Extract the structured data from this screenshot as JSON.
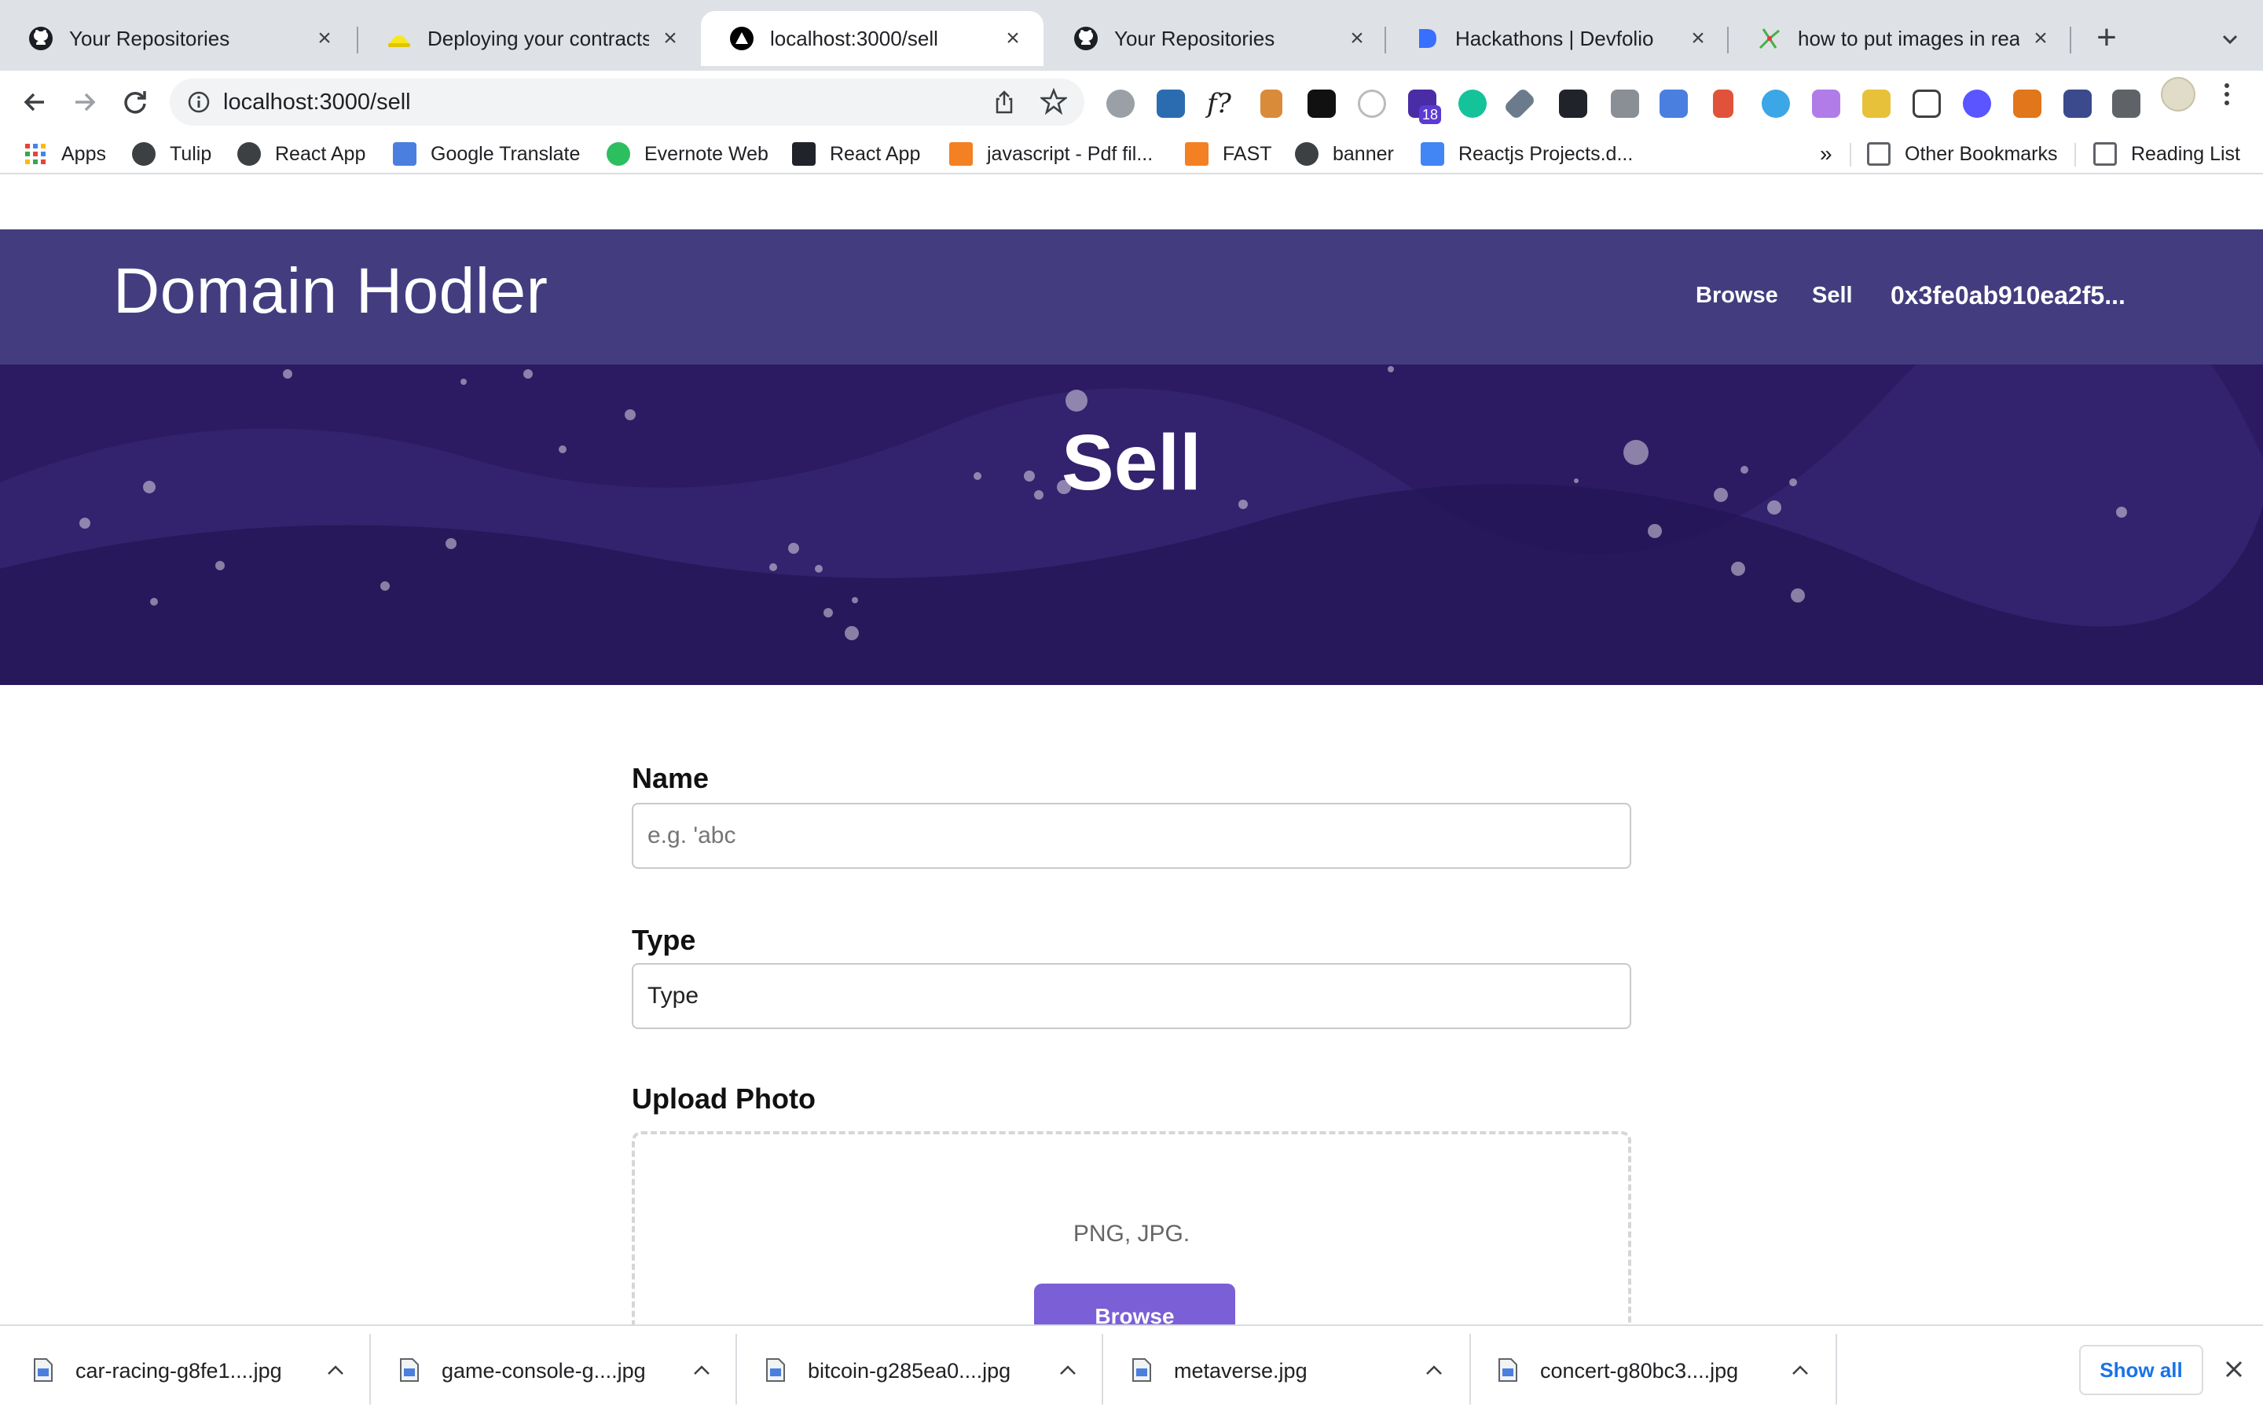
{
  "browser": {
    "tabs": [
      {
        "title": "Your Repositories",
        "icon": "github-icon",
        "active": false
      },
      {
        "title": "Deploying your contracts | Hardhat",
        "icon": "hardhat-icon",
        "active": false
      },
      {
        "title": "localhost:3000/sell",
        "icon": "triangle-icon",
        "active": true
      },
      {
        "title": "Your Repositories",
        "icon": "github-icon",
        "active": false
      },
      {
        "title": "Hackathons | Devfolio",
        "icon": "devfolio-icon",
        "active": false
      },
      {
        "title": "how to put images in readme",
        "icon": "stackoverflow-icon",
        "active": false
      }
    ],
    "url": "localhost:3000/sell",
    "extension_badge": "18",
    "bookmarks": [
      {
        "label": "Apps",
        "icon": "apps-grid-icon"
      },
      {
        "label": "Tulip",
        "icon": "globe-icon"
      },
      {
        "label": "React App",
        "icon": "globe-icon"
      },
      {
        "label": "Google Translate",
        "icon": "translate-icon"
      },
      {
        "label": "Evernote Web",
        "icon": "evernote-icon"
      },
      {
        "label": "React App",
        "icon": "react-icon"
      },
      {
        "label": "javascript - Pdf fil...",
        "icon": "stackoverflow-icon"
      },
      {
        "label": "FAST",
        "icon": "stackoverflow-icon"
      },
      {
        "label": "banner",
        "icon": "globe-icon"
      },
      {
        "label": "Reactjs Projects.d...",
        "icon": "docs-icon"
      }
    ],
    "bookmarks_overflow": "»",
    "other_bookmarks": "Other Bookmarks",
    "reading_list": "Reading List"
  },
  "page": {
    "brand": "Domain Hodler",
    "nav_links": {
      "browse": "Browse",
      "sell": "Sell",
      "account": "0x3fe0ab910ea2f5..."
    },
    "hero_title": "Sell",
    "form": {
      "name_label": "Name",
      "name_placeholder": "e.g. 'abc",
      "type_label": "Type",
      "type_value": "Type",
      "upload_label": "Upload Photo",
      "upload_hint": "PNG, JPG.",
      "browse_button": "Browse"
    },
    "colors": {
      "nav": "#433d7f",
      "hero": "#2c1a63",
      "button": "#7a5fd6"
    }
  },
  "downloads": {
    "items": [
      "car-racing-g8fe1....jpg",
      "game-console-g....jpg",
      "bitcoin-g285ea0....jpg",
      "metaverse.jpg",
      "concert-g80bc3....jpg"
    ],
    "show_all": "Show all"
  }
}
